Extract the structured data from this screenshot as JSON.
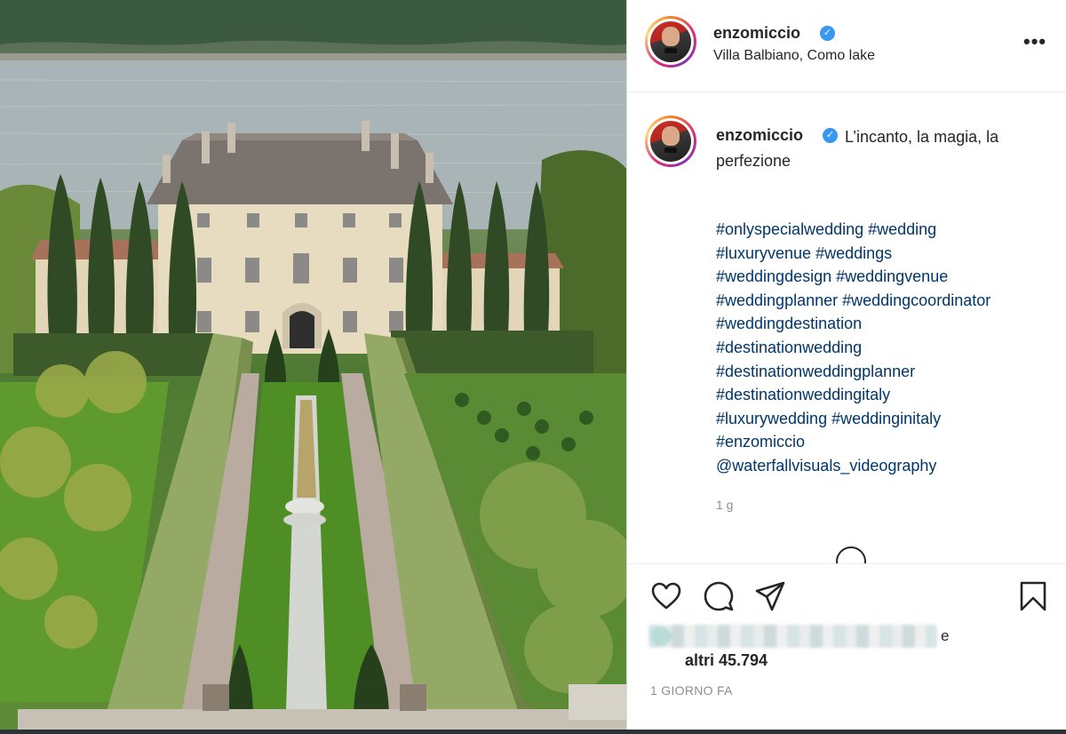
{
  "post": {
    "image_description_icon": "photo-villa-garden"
  },
  "header": {
    "username": "enzomiccio",
    "location": "Villa Balbiano, Como lake",
    "more_glyph": "•••"
  },
  "caption": {
    "username": "enzomiccio",
    "text": "L’incanto, la magia, la perfezione",
    "hashtags": [
      "#onlyspecialwedding #wedding",
      "#luxuryvenue #weddings",
      "#weddingdesign #weddingvenue",
      "#weddingplanner #weddingcoordinator",
      "#weddingdestination",
      "#destinationwedding",
      "#destinationweddingplanner",
      "#destinationweddingitaly",
      "#luxurywedding #weddinginitaly",
      "#enzomiccio",
      "@waterfallvisuals_videography"
    ],
    "time": "1 g"
  },
  "actions": {
    "likes_suffix": "e",
    "likes_others": "altri 45.794",
    "timestamp": "1 GIORNO FA"
  },
  "colors": {
    "link": "#00376b",
    "verified": "#3897f0",
    "text": "#262626",
    "muted": "#8e8e8e"
  }
}
